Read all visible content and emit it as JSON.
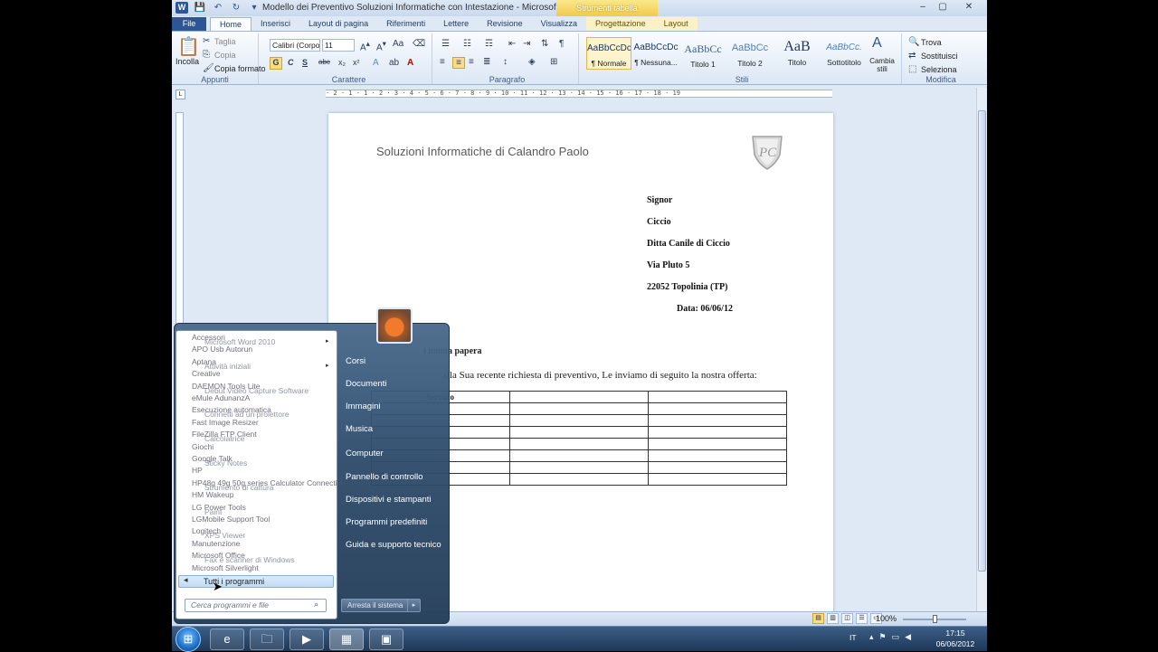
{
  "window": {
    "title": "Modello dei Preventivo Soluzioni Informatiche con Intestazione - Microsoft Word",
    "context_tab_title": "Strumenti tabella",
    "minimize": "–",
    "maximize": "▢",
    "close": "✕"
  },
  "tabs": [
    "File",
    "Home",
    "Inserisci",
    "Layout di pagina",
    "Riferimenti",
    "Lettere",
    "Revisione",
    "Visualizza",
    "Progettazione",
    "Layout"
  ],
  "ribbon": {
    "clipboard": {
      "paste": "Incolla",
      "cut": "Taglia",
      "copy": "Copia",
      "format_painter": "Copia formato",
      "label": "Appunti"
    },
    "font": {
      "family": "Calibri (Corpo",
      "size": "11",
      "bold": "G",
      "italic": "C",
      "underline": "S",
      "strike": "abc",
      "label": "Carattere"
    },
    "paragraph": {
      "label": "Paragrafo"
    },
    "styles": {
      "items": [
        {
          "sample": "AaBbCcDc",
          "name": "¶ Normale"
        },
        {
          "sample": "AaBbCcDc",
          "name": "¶ Nessuna..."
        },
        {
          "sample": "AaBbCc",
          "name": "Titolo 1"
        },
        {
          "sample": "AaBbCc",
          "name": "Titolo 2"
        },
        {
          "sample": "AaB",
          "name": "Titolo"
        },
        {
          "sample": "AaBbCc.",
          "name": "Sottotitolo"
        }
      ],
      "change": "Cambia stili",
      "label": "Stili"
    },
    "editing": {
      "find": "Trova",
      "replace": "Sostituisci",
      "select": "Seleziona",
      "label": "Modifica"
    }
  },
  "ruler": {
    "numbers": "· 2 · 1 · 1 · 2 · 3 · 4 · 5 · 6 · 7 · 8 · 9 · 10 · 11 · 12 · 13 · 14 · 15 · 16 · 17 · 18 · 19"
  },
  "document": {
    "company": "Soluzioni Informatiche di Calandro Paolo",
    "address": [
      "Signor",
      "Ciccio",
      "Ditta Canile di Ciccio",
      "Via Pluto 5",
      "22052  Topolinia (TP)"
    ],
    "date": "Data: 06/06/12",
    "subject": "i nonna papera",
    "body": "alla Sua recente richiesta di preventivo, Le inviamo di seguito la nostra offerta:",
    "table_header": "Servizio"
  },
  "statusbar": {
    "zoom": "100%"
  },
  "start_menu": {
    "programs": [
      {
        "name": "Accessori",
        "overlay": "Microsoft Word 2010"
      },
      {
        "name": "APO Usb Autorun",
        "overlay": ""
      },
      {
        "name": "Aptana",
        "overlay": "Attività iniziali"
      },
      {
        "name": "Creative",
        "overlay": ""
      },
      {
        "name": "DAEMON Tools Lite",
        "overlay": "Debut Video Capture Software"
      },
      {
        "name": "eMule AdunanzA",
        "overlay": ""
      },
      {
        "name": "Esecuzione automatica",
        "overlay": "Connetti ad un proiettore"
      },
      {
        "name": "Fast Image Resizer",
        "overlay": ""
      },
      {
        "name": "FileZilla FTP Client",
        "overlay": "Calcolatrice"
      },
      {
        "name": "Giochi",
        "overlay": ""
      },
      {
        "name": "Google Talk",
        "overlay": "Sticky Notes"
      },
      {
        "name": "HP",
        "overlay": ""
      },
      {
        "name": "HP48g 49g 50g series Calculator Connectivi",
        "overlay": "Strumento di cattura"
      },
      {
        "name": "HM Wakeup",
        "overlay": ""
      },
      {
        "name": "LG Power Tools",
        "overlay": "Paint"
      },
      {
        "name": "LGMobile Support Tool",
        "overlay": ""
      },
      {
        "name": "Logitech",
        "overlay": "XPS Viewer"
      },
      {
        "name": "Manutenzione",
        "overlay": ""
      },
      {
        "name": "Microsoft Office",
        "overlay": "Fax e scanner di Windows"
      },
      {
        "name": "Microsoft Silverlight",
        "overlay": ""
      }
    ],
    "all_programs": "Tutti i programmi",
    "search_placeholder": "Cerca programmi e file",
    "right_items": [
      "Corsi",
      "Documenti",
      "Immagini",
      "Musica",
      "Computer",
      "Pannello di controllo",
      "Dispositivi e stampanti",
      "Programmi predefiniti",
      "Guida e supporto tecnico"
    ],
    "shutdown": "Arresta il sistema"
  },
  "taskbar": {
    "language": "IT",
    "time": "17:15",
    "date": "06/06/2012"
  }
}
